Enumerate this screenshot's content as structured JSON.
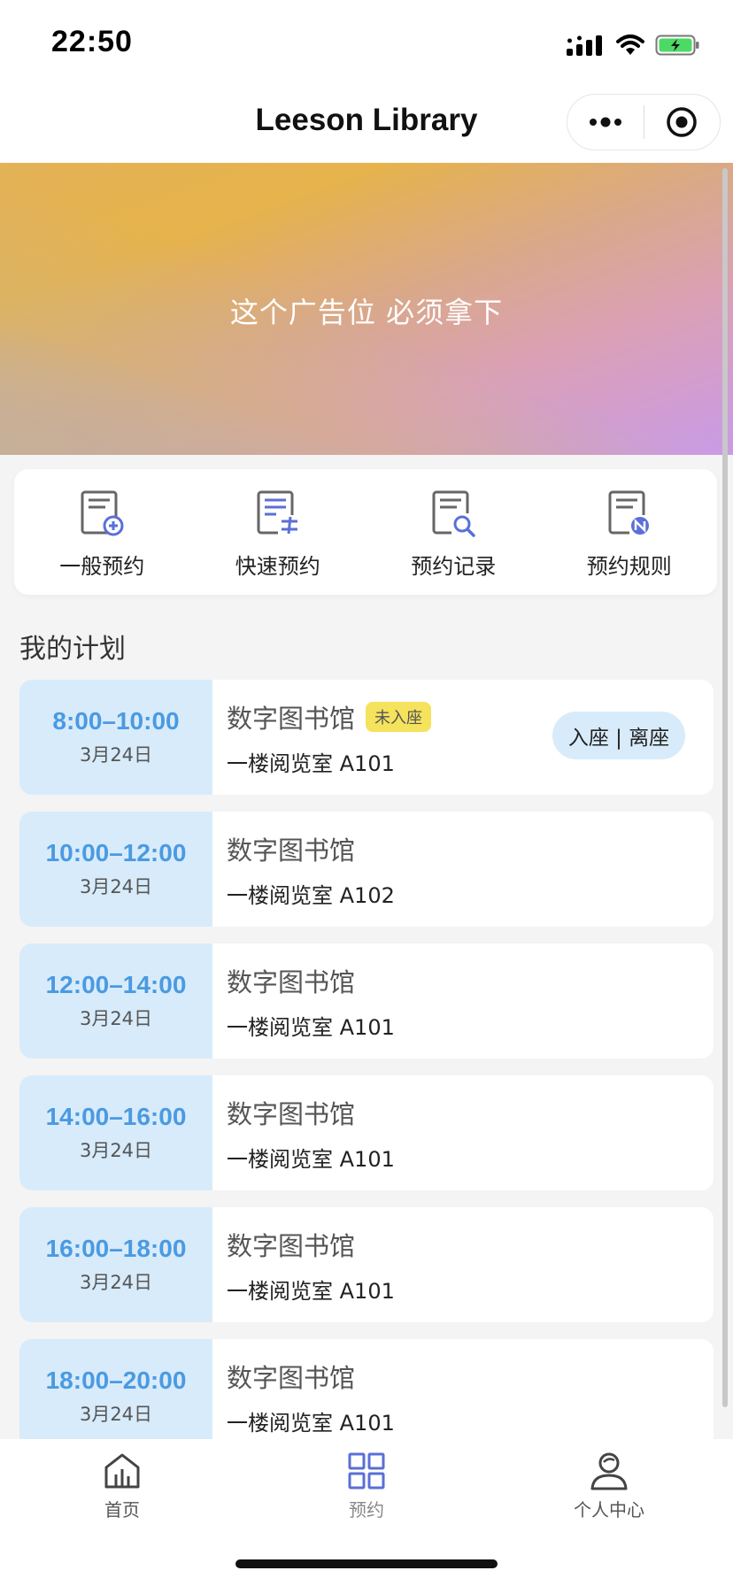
{
  "status_bar": {
    "time": "22:50"
  },
  "nav": {
    "title": "Leeson Library"
  },
  "banner": {
    "text": "这个广告位 必须拿下"
  },
  "quick_menu": [
    {
      "label": "一般预约",
      "icon": "document-add-icon"
    },
    {
      "label": "快速预约",
      "icon": "document-swap-icon"
    },
    {
      "label": "预约记录",
      "icon": "document-search-icon"
    },
    {
      "label": "预约规则",
      "icon": "document-rules-icon"
    }
  ],
  "section": {
    "title": "我的计划"
  },
  "plans": [
    {
      "time": "8:00–10:00",
      "date": "3月24日",
      "library": "数字图书馆",
      "badge": "未入座",
      "room": "一楼阅览室 A101",
      "action": "入座 | 离座"
    },
    {
      "time": "10:00–12:00",
      "date": "3月24日",
      "library": "数字图书馆",
      "room": "一楼阅览室 A102"
    },
    {
      "time": "12:00–14:00",
      "date": "3月24日",
      "library": "数字图书馆",
      "room": "一楼阅览室 A101"
    },
    {
      "time": "14:00–16:00",
      "date": "3月24日",
      "library": "数字图书馆",
      "room": "一楼阅览室 A101"
    },
    {
      "time": "16:00–18:00",
      "date": "3月24日",
      "library": "数字图书馆",
      "room": "一楼阅览室 A101"
    },
    {
      "time": "18:00–20:00",
      "date": "3月24日",
      "library": "数字图书馆",
      "room": "一楼阅览室 A101"
    }
  ],
  "tabs": [
    {
      "label": "首页",
      "icon": "home-icon"
    },
    {
      "label": "预约",
      "icon": "grid-icon",
      "active": true
    },
    {
      "label": "个人中心",
      "icon": "user-icon"
    }
  ],
  "colors": {
    "accent": "#4a9ae2",
    "time_box_bg": "#d8ebfa",
    "badge_bg": "#f5e25d",
    "icon_blue": "#5b6fd6"
  }
}
